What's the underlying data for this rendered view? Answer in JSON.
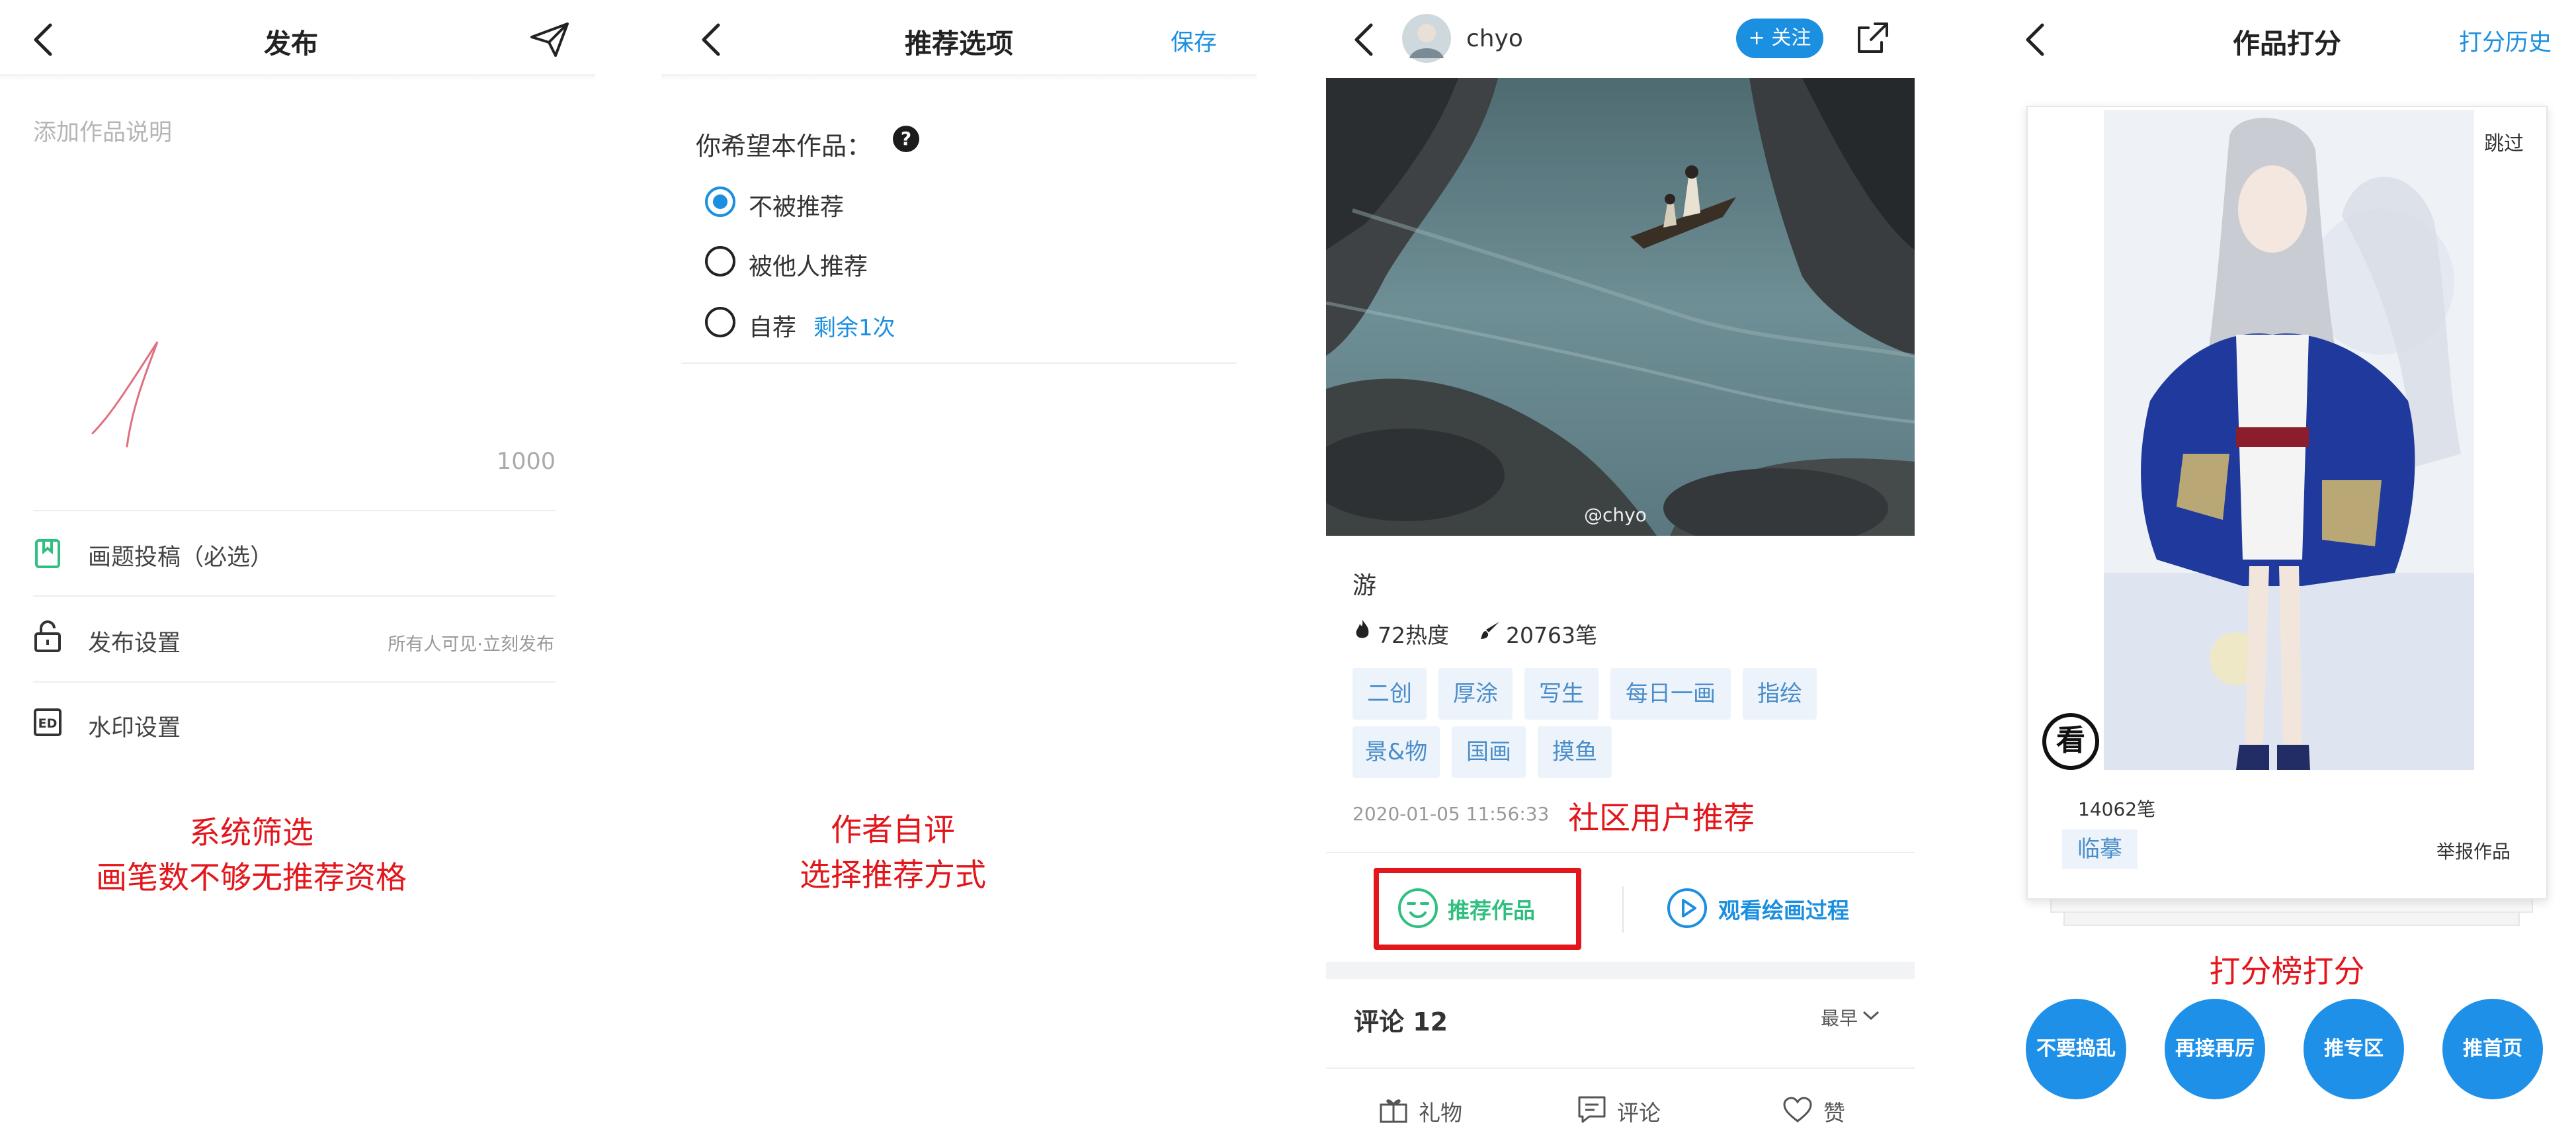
{
  "publish": {
    "title": "发布",
    "desc_placeholder": "添加作品说明",
    "char_count": "1000",
    "rows": [
      {
        "label": "画题投稿（必选）",
        "value": ""
      },
      {
        "label": "发布设置",
        "value": "所有人可见·立刻发布"
      },
      {
        "label": "水印设置",
        "value": ""
      }
    ],
    "annotation_line1": "系统筛选",
    "annotation_line2": "画笔数不够无推荐资格"
  },
  "recommend": {
    "title": "推荐选项",
    "save": "保存",
    "question": "你希望本作品：",
    "help_glyph": "?",
    "options": [
      {
        "label": "不被推荐",
        "selected": true
      },
      {
        "label": "被他人推荐",
        "selected": false
      },
      {
        "label": "自荐",
        "selected": false,
        "extra": "剩余1次"
      }
    ],
    "annotation_line1": "作者自评",
    "annotation_line2": "选择推荐方式"
  },
  "artwork": {
    "username": "chyo",
    "follow": "+ 关注",
    "watermark": "@chyo",
    "work_title": "游",
    "heat": "72热度",
    "strokes": "20763笔",
    "tags_row1": [
      "二创",
      "厚涂",
      "写生",
      "每日一画",
      "指绘"
    ],
    "tags_row2": [
      "景&物",
      "国画",
      "摸鱼"
    ],
    "date": "2020-01-05 11:56:33",
    "annotation": "社区用户推荐",
    "recommend_btn": "推荐作品",
    "watch_btn": "观看绘画过程",
    "comments": "评论 12",
    "sort": "最早",
    "bottom_bar": [
      "礼物",
      "评论",
      "赞"
    ]
  },
  "rating": {
    "title": "作品打分",
    "history": "打分历史",
    "skip": "跳过",
    "look_glyph": "看",
    "strokes": "14062笔",
    "tag": "临摹",
    "report": "举报作品",
    "annotation": "打分榜打分",
    "buttons": [
      "不要捣乱",
      "再接再厉",
      "推专区",
      "推首页"
    ]
  },
  "colors": {
    "accent": "#1b8fe0",
    "annotation_red": "#e3161b",
    "recommend_green": "#2fc07f",
    "tag_bg": "#ecf3fb"
  },
  "icons": [
    "back-arrow-icon",
    "send-icon",
    "bookmark-icon",
    "lock-icon",
    "watermark-icon",
    "help-icon",
    "share-icon",
    "flame-icon",
    "brush-icon",
    "smile-face-icon",
    "play-icon",
    "chevron-down-icon",
    "gift-icon",
    "comment-icon",
    "heart-icon",
    "look-stamp-icon"
  ]
}
